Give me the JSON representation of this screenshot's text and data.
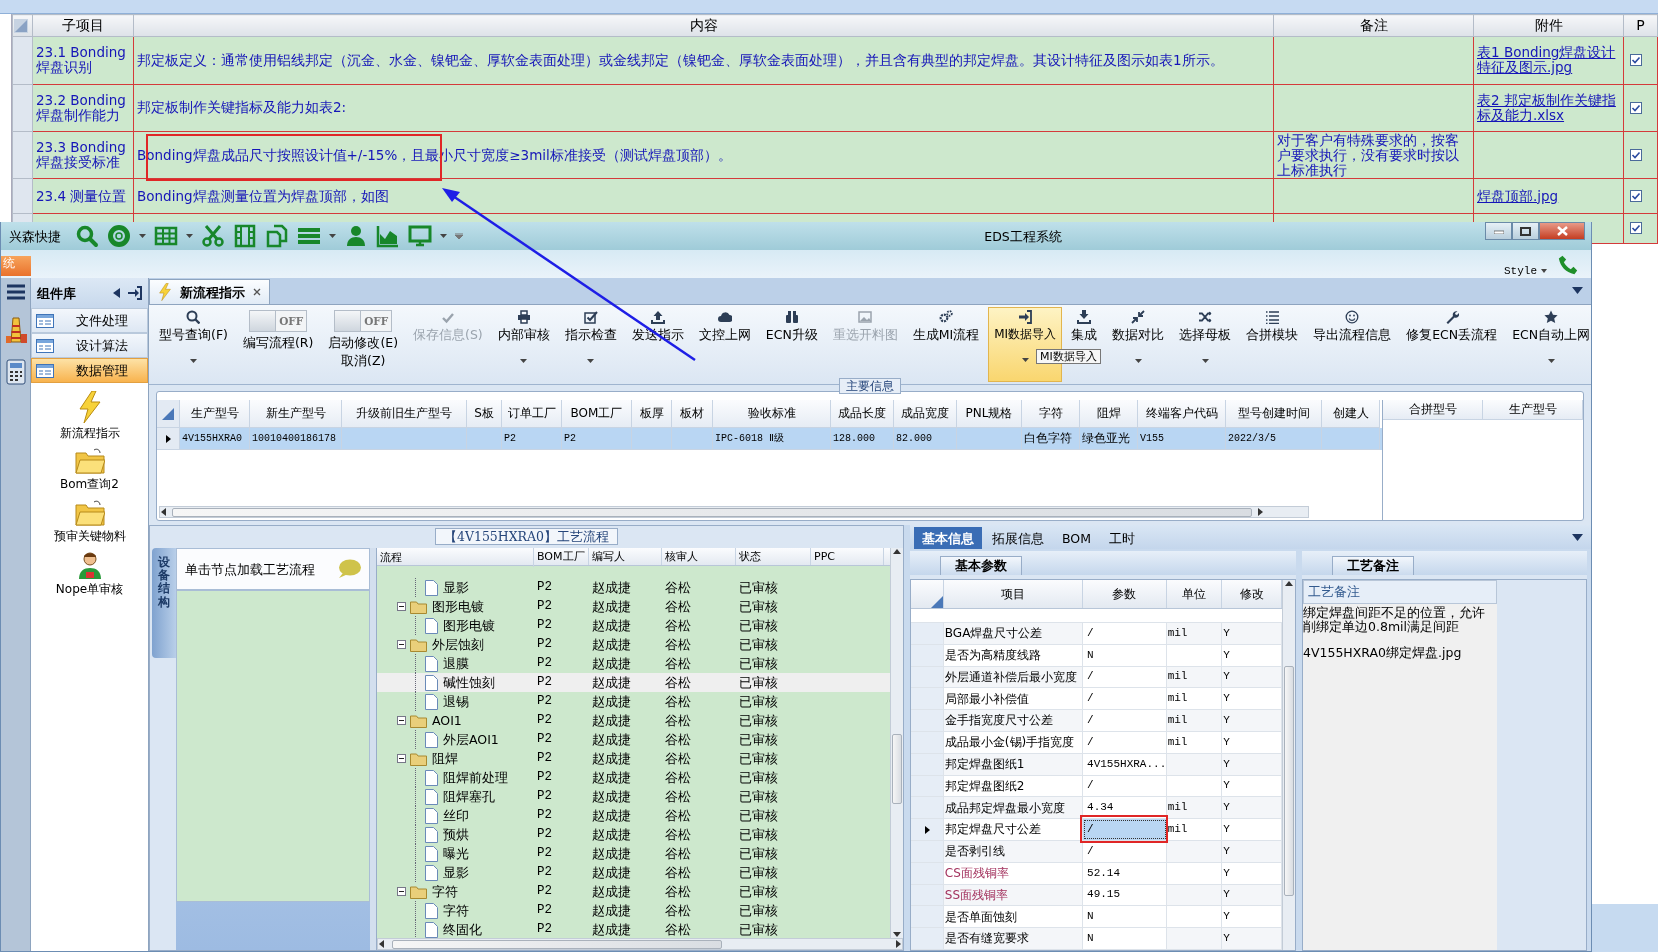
{
  "background_sheet": {
    "columns": [
      "子项目",
      "内容",
      "备注",
      "附件",
      "P"
    ],
    "rows": [
      {
        "subitem": "23.1 Bonding焊盘识别",
        "content": "邦定板定义：通常使用铝线邦定（沉金、水金、镍钯金、厚软金表面处理）或金线邦定（镍钯金、厚软金表面处理），并且含有典型的邦定焊盘。其设计特征及图示如表1所示。",
        "attachment": "表1 Bonding焊盘设计特征及图示.jpg",
        "checked": true
      },
      {
        "subitem": "23.2 Bonding焊盘制作能力",
        "content": "邦定板制作关键指标及能力如表2:",
        "attachment": "表2 邦定板制作关键指标及能力.xlsx",
        "checked": true
      },
      {
        "subitem": "23.3 Bonding焊盘接受标准",
        "content": "Bonding焊盘成品尺寸按照设计值+/-15%，且最小尺寸宽度≥3mil标准接受（测试焊盘顶部）。",
        "remark": "对于客户有特殊要求的，按客户要求执行，没有要求时按以上标准执行",
        "checked": true
      },
      {
        "subitem": "23.4 测量位置",
        "content": "Bonding焊盘测量位置为焊盘顶部，如图",
        "attachment": "焊盘顶部.jpg",
        "checked": true
      },
      {
        "checked": true
      }
    ]
  },
  "window": {
    "title": "EDS工程系统",
    "quick_access_label": "兴森快捷",
    "system_tab": "统",
    "style_menu": "Style"
  },
  "component_library": {
    "title": "组件库",
    "categories": [
      {
        "label": "文件处理",
        "selected": false
      },
      {
        "label": "设计算法",
        "selected": false
      },
      {
        "label": "数据管理",
        "selected": true
      }
    ],
    "tools": [
      {
        "label": "新流程指示",
        "kind": "lightning"
      },
      {
        "label": "Bom查询2",
        "kind": "folder"
      },
      {
        "label": "预审关键物料",
        "kind": "folder"
      },
      {
        "label": "Nope单审核",
        "kind": "person"
      }
    ]
  },
  "document_tab": {
    "label": "新流程指示"
  },
  "ribbon": [
    {
      "kind": "button",
      "label": "型号查询(F)",
      "disabled": false,
      "dropdown": true,
      "highlighted": false
    },
    {
      "kind": "toggle",
      "label": "编写流程(R)",
      "switch_text": "OFF",
      "on": false
    },
    {
      "kind": "toggle",
      "label": "启动修改(E)",
      "sublabel": "取消(Z)",
      "switch_text": "OFF",
      "on": false
    },
    {
      "kind": "button",
      "label": "保存信息(S)",
      "disabled": true,
      "dropdown": false,
      "highlighted": false
    },
    {
      "kind": "button",
      "label": "内部审核",
      "disabled": false,
      "dropdown": true,
      "highlighted": false
    },
    {
      "kind": "button",
      "label": "指示检查",
      "disabled": false,
      "dropdown": true,
      "highlighted": false
    },
    {
      "kind": "button",
      "label": "发送指示",
      "disabled": false,
      "dropdown": false,
      "highlighted": false
    },
    {
      "kind": "button",
      "label": "文控上网",
      "disabled": false,
      "dropdown": false,
      "highlighted": false
    },
    {
      "kind": "button",
      "label": "ECN升级",
      "disabled": false,
      "dropdown": false,
      "highlighted": false
    },
    {
      "kind": "button",
      "label": "重选开料图",
      "disabled": true,
      "dropdown": false,
      "highlighted": false
    },
    {
      "kind": "button",
      "label": "生成MI流程",
      "disabled": false,
      "dropdown": false,
      "highlighted": false
    },
    {
      "kind": "button",
      "label": "MI数据导入",
      "disabled": false,
      "dropdown": true,
      "highlighted": true
    },
    {
      "kind": "button",
      "label": "集成",
      "disabled": false,
      "dropdown": false,
      "highlighted": false
    },
    {
      "kind": "button",
      "label": "数据对比",
      "disabled": false,
      "dropdown": true,
      "highlighted": false
    },
    {
      "kind": "button",
      "label": "选择母板",
      "disabled": false,
      "dropdown": true,
      "highlighted": false
    },
    {
      "kind": "button",
      "label": "合拼模块",
      "disabled": false,
      "dropdown": false,
      "highlighted": false
    },
    {
      "kind": "button",
      "label": "导出流程信息",
      "disabled": false,
      "dropdown": false,
      "highlighted": false
    },
    {
      "kind": "button",
      "label": "修复ECN丢流程",
      "disabled": false,
      "dropdown": false,
      "highlighted": false
    },
    {
      "kind": "button",
      "label": "ECN自动上网",
      "disabled": false,
      "dropdown": true,
      "highlighted": false
    }
  ],
  "tooltip": {
    "text": "MI数据导入"
  },
  "main_info": {
    "title": "主要信息",
    "columns": [
      "生产型号",
      "新生产型号",
      "升级前旧生产型号",
      "S板",
      "订单工厂",
      "BOM工厂",
      "板厚",
      "板材",
      "验收标准",
      "成品长度",
      "成品宽度",
      "PNL规格",
      "字符",
      "阻焊",
      "终端客户代码",
      "型号创建时间",
      "创建人"
    ],
    "rows": [
      {
        "cells": [
          "4V155HXRA0",
          "10010400186178",
          null,
          null,
          "P2",
          "P2",
          null,
          null,
          "IPC-6018 Ⅱ级",
          "128.000",
          "82.000",
          null,
          "白色字符",
          "绿色亚光",
          "V155",
          "2022/3/5",
          null
        ],
        "selected": true
      }
    ],
    "merge_columns": [
      "合拼型号",
      "生产型号"
    ]
  },
  "process_flow": {
    "title": "【4V155HXRA0】工艺流程",
    "side_tab": "设备结构",
    "hint": "单击节点加载工艺流程",
    "columns": [
      "流程",
      "BOM工厂",
      "编写人",
      "核审人",
      "状态",
      "PPC"
    ],
    "nodes": [
      {
        "kind": "step",
        "label": "显影",
        "bom": "P2",
        "writer": "赵成捷",
        "reviewer": "谷松",
        "status": "已审核",
        "selected": false
      },
      {
        "kind": "group",
        "label": "图形电镀",
        "bom": "P2",
        "writer": "赵成捷",
        "reviewer": "谷松",
        "status": "已审核",
        "selected": false,
        "expanded": true,
        "children": [
          {
            "kind": "step",
            "label": "图形电镀",
            "bom": "P2",
            "writer": "赵成捷",
            "reviewer": "谷松",
            "status": "已审核",
            "selected": false
          }
        ]
      },
      {
        "kind": "group",
        "label": "外层蚀刻",
        "bom": "P2",
        "writer": "赵成捷",
        "reviewer": "谷松",
        "status": "已审核",
        "selected": false,
        "expanded": true,
        "children": [
          {
            "kind": "step",
            "label": "退膜",
            "bom": "P2",
            "writer": "赵成捷",
            "reviewer": "谷松",
            "status": "已审核",
            "selected": false
          },
          {
            "kind": "step",
            "label": "碱性蚀刻",
            "bom": "P2",
            "writer": "赵成捷",
            "reviewer": "谷松",
            "status": "已审核",
            "selected": true
          },
          {
            "kind": "step",
            "label": "退锡",
            "bom": "P2",
            "writer": "赵成捷",
            "reviewer": "谷松",
            "status": "已审核",
            "selected": false
          }
        ]
      },
      {
        "kind": "group",
        "label": "AOI1",
        "bom": "P2",
        "writer": "赵成捷",
        "reviewer": "谷松",
        "status": "已审核",
        "selected": false,
        "expanded": true,
        "children": [
          {
            "kind": "step",
            "label": "外层AOI1",
            "bom": "P2",
            "writer": "赵成捷",
            "reviewer": "谷松",
            "status": "已审核",
            "selected": false
          }
        ]
      },
      {
        "kind": "group",
        "label": "阻焊",
        "bom": "P2",
        "writer": "赵成捷",
        "reviewer": "谷松",
        "status": "已审核",
        "selected": false,
        "expanded": true,
        "children": [
          {
            "kind": "step",
            "label": "阻焊前处理",
            "bom": "P2",
            "writer": "赵成捷",
            "reviewer": "谷松",
            "status": "已审核",
            "selected": false
          },
          {
            "kind": "step",
            "label": "阻焊塞孔",
            "bom": "P2",
            "writer": "赵成捷",
            "reviewer": "谷松",
            "status": "已审核",
            "selected": false
          },
          {
            "kind": "step",
            "label": "丝印",
            "bom": "P2",
            "writer": "赵成捷",
            "reviewer": "谷松",
            "status": "已审核",
            "selected": false
          },
          {
            "kind": "step",
            "label": "预烘",
            "bom": "P2",
            "writer": "赵成捷",
            "reviewer": "谷松",
            "status": "已审核",
            "selected": false
          },
          {
            "kind": "step",
            "label": "曝光",
            "bom": "P2",
            "writer": "赵成捷",
            "reviewer": "谷松",
            "status": "已审核",
            "selected": false
          },
          {
            "kind": "step",
            "label": "显影",
            "bom": "P2",
            "writer": "赵成捷",
            "reviewer": "谷松",
            "status": "已审核",
            "selected": false
          }
        ]
      },
      {
        "kind": "group",
        "label": "字符",
        "bom": "P2",
        "writer": "赵成捷",
        "reviewer": "谷松",
        "status": "已审核",
        "selected": false,
        "expanded": true,
        "children": [
          {
            "kind": "step",
            "label": "字符",
            "bom": "P2",
            "writer": "赵成捷",
            "reviewer": "谷松",
            "status": "已审核",
            "selected": false
          },
          {
            "kind": "step",
            "label": "终固化",
            "bom": "P2",
            "writer": "赵成捷",
            "reviewer": "谷松",
            "status": "已审核",
            "selected": false
          }
        ]
      }
    ]
  },
  "detail_tabs": [
    {
      "label": "基本信息",
      "selected": true
    },
    {
      "label": "拓展信息",
      "selected": false
    },
    {
      "label": "BOM",
      "selected": false
    },
    {
      "label": "工时",
      "selected": false
    }
  ],
  "basic_params": {
    "title": "基本参数",
    "columns": [
      "项目",
      "参数",
      "单位",
      "修改"
    ],
    "rows": [
      {
        "item": "BGA焊盘尺寸公差",
        "value": "/",
        "unit": "mil",
        "modified": "Y",
        "selected": false,
        "flagged": false
      },
      {
        "item": "是否为高精度线路",
        "value": "N",
        "modified": "Y",
        "selected": false,
        "flagged": false
      },
      {
        "item": "外层通道补偿后最小宽度",
        "value": "/",
        "unit": "mil",
        "modified": "Y",
        "selected": false,
        "flagged": false
      },
      {
        "item": "局部最小补偿值",
        "value": "/",
        "unit": "mil",
        "modified": "Y",
        "selected": false,
        "flagged": false
      },
      {
        "item": "金手指宽度尺寸公差",
        "value": "/",
        "unit": "mil",
        "modified": "Y",
        "selected": false,
        "flagged": false
      },
      {
        "item": "成品最小金(锡)手指宽度",
        "value": "/",
        "unit": "mil",
        "modified": "Y",
        "selected": false,
        "flagged": false
      },
      {
        "item": "邦定焊盘图纸1",
        "value": "4V155HXRA...",
        "modified": "Y",
        "selected": false,
        "flagged": false
      },
      {
        "item": "邦定焊盘图纸2",
        "value": "/",
        "modified": "Y",
        "selected": false,
        "flagged": false
      },
      {
        "item": "成品邦定焊盘最小宽度",
        "value": "4.34",
        "unit": "mil",
        "modified": "Y",
        "selected": false,
        "flagged": false
      },
      {
        "item": "邦定焊盘尺寸公差",
        "value": "/",
        "unit": "mil",
        "modified": "Y",
        "selected": true,
        "flagged": false
      },
      {
        "item": "是否剥引线",
        "value": "/",
        "modified": "Y",
        "selected": false,
        "flagged": false
      },
      {
        "item": "CS面残铜率",
        "value": "52.14",
        "modified": "Y",
        "selected": false,
        "flagged": true
      },
      {
        "item": "SS面残铜率",
        "value": "49.15",
        "modified": "Y",
        "selected": false,
        "flagged": true
      },
      {
        "item": "是否单面蚀刻",
        "value": "N",
        "modified": "Y",
        "selected": false,
        "flagged": false
      },
      {
        "item": "是否有缝宽要求",
        "value": "N",
        "modified": "Y",
        "selected": false,
        "flagged": false
      }
    ]
  },
  "process_notes": {
    "title": "工艺备注",
    "column": "工艺备注",
    "lines": [
      "绑定焊盘间距不足的位置，允许削绑定单边0.8mil满足间距",
      "4V155HXRA0绑定焊盘.jpg"
    ]
  },
  "annotations": [
    {
      "kind": "box"
    },
    {
      "kind": "arrow"
    },
    {
      "kind": "box"
    }
  ]
}
